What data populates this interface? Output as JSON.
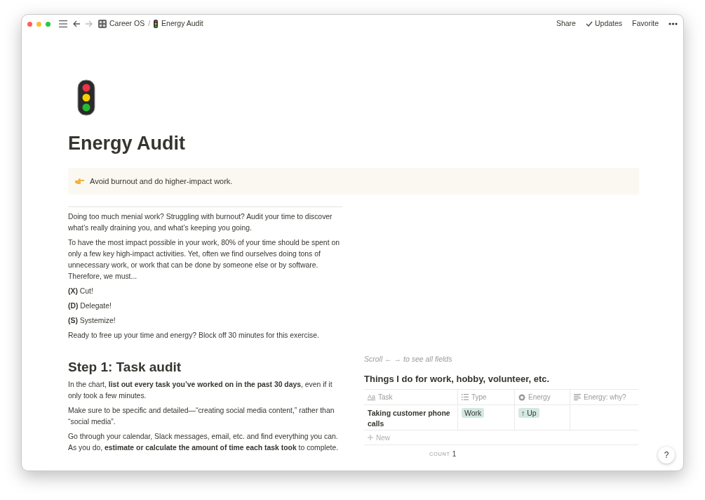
{
  "breadcrumbs": [
    {
      "label": "Career OS",
      "kind": "workspace"
    },
    {
      "label": "Energy Audit",
      "kind": "page"
    }
  ],
  "separator": "/",
  "actions": [
    {
      "label": "Share",
      "kind": "text"
    },
    {
      "label": "Updates",
      "kind": "check"
    },
    {
      "label": "Favorite",
      "kind": "text"
    }
  ],
  "title": "Energy Audit",
  "callout": "Avoid burnout and do higher-impact work.",
  "intro": [
    "Doing too much menial work? Struggling with burnout? Audit your time to discover what’s really draining you, and what’s keeping you going.",
    "To have the most impact possible in your work, 80% of your time should be spent on only a few key high-impact activities. Yet, often we find ourselves doing tons of unnecessary work, or work that can be done by someone else or by software. Therefore, we must...",
    "**(X)** Cut!",
    "**(D)** Delegate!",
    "**(S)** Systemize!",
    "Ready to free up your time and energy? Block off 30 minutes for this exercise."
  ],
  "step1": {
    "heading": "Step 1: Task audit",
    "paragraphs": [
      "In the chart, **list out every task you’ve worked on in the past 30 days**, even if it only took a few minutes.",
      "Make sure to be specific and detailed—“creating social media content,” rather than “social media”.",
      "Go through your calendar, Slack messages, email, etc. and find everything you can. As you do, **estimate or calculate the amount of time each task took** to complete."
    ]
  },
  "database": {
    "hint": "Scroll ← → to see all fields",
    "title": "Things I do for work, hobby, volunteer, etc.",
    "columns": [
      {
        "label": "Task",
        "kind": "title",
        "icon": "Aa"
      },
      {
        "label": "Type",
        "kind": "select"
      },
      {
        "label": "Energy",
        "kind": "status"
      },
      {
        "label": "Energy: why?",
        "kind": "text"
      }
    ],
    "rows": [
      {
        "cells": [
          {
            "kind": "text",
            "value": "Taking customer phone calls"
          },
          {
            "kind": "tag",
            "value": "Work",
            "color": "#d3e8e3"
          },
          {
            "kind": "tag",
            "value": "↑ Up",
            "color": "#d3e8e3"
          },
          {
            "kind": "empty"
          }
        ]
      }
    ],
    "new_label": "New",
    "count_label": "COUNT",
    "count": "1"
  },
  "help": "?"
}
